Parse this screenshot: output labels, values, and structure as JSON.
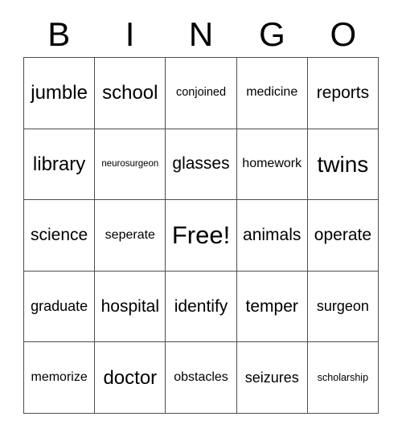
{
  "card": {
    "type": "bingo-card",
    "header_letters": [
      "B",
      "I",
      "N",
      "G",
      "O"
    ],
    "free_space_label": "Free!",
    "grid_size": "5x5",
    "colors": {
      "text": "#000000",
      "grid_line": "#4d4d4d",
      "background": "#ffffff"
    },
    "rows": [
      [
        {
          "label": "jumble",
          "size": "fs-ml"
        },
        {
          "label": "school",
          "size": "fs-ml"
        },
        {
          "label": "conjoined",
          "size": "fs-xxs"
        },
        {
          "label": "medicine",
          "size": "fs-xs"
        },
        {
          "label": "reports",
          "size": "fs-md"
        }
      ],
      [
        {
          "label": "library",
          "size": "fs-ml"
        },
        {
          "label": "neurosurgeon",
          "size": "fs-mini"
        },
        {
          "label": "glasses",
          "size": "fs-md"
        },
        {
          "label": "homework",
          "size": "fs-xs"
        },
        {
          "label": "twins",
          "size": "fs-lg"
        }
      ],
      [
        {
          "label": "science",
          "size": "fs-md"
        },
        {
          "label": "seperate",
          "size": "fs-xs"
        },
        {
          "label": "Free!",
          "size": "fs-xl"
        },
        {
          "label": "animals",
          "size": "fs-md"
        },
        {
          "label": "operate",
          "size": "fs-md"
        }
      ],
      [
        {
          "label": "graduate",
          "size": "fs-sm"
        },
        {
          "label": "hospital",
          "size": "fs-md"
        },
        {
          "label": "identify",
          "size": "fs-md"
        },
        {
          "label": "temper",
          "size": "fs-md"
        },
        {
          "label": "surgeon",
          "size": "fs-sm"
        }
      ],
      [
        {
          "label": "memorize",
          "size": "fs-xs"
        },
        {
          "label": "doctor",
          "size": "fs-ml"
        },
        {
          "label": "obstacles",
          "size": "fs-xs"
        },
        {
          "label": "seizures",
          "size": "fs-sm"
        },
        {
          "label": "scholarship",
          "size": "fs-tiny"
        }
      ]
    ]
  }
}
